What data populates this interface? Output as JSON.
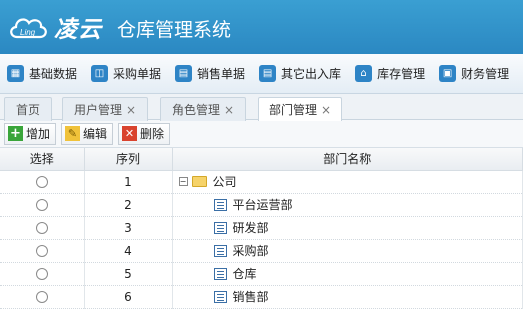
{
  "header": {
    "brand": "凌云",
    "logo_text": "Ling",
    "title": "仓库管理系统"
  },
  "nav": {
    "items": [
      {
        "label": "基础数据",
        "icon": "database-icon"
      },
      {
        "label": "采购单据",
        "icon": "basket-icon"
      },
      {
        "label": "销售单据",
        "icon": "calendar-icon"
      },
      {
        "label": "其它出入库",
        "icon": "calendar-icon"
      },
      {
        "label": "库存管理",
        "icon": "home-icon"
      },
      {
        "label": "财务管理",
        "icon": "finance-icon"
      }
    ]
  },
  "tabs": [
    {
      "label": "首页"
    },
    {
      "label": "用户管理",
      "close": "×"
    },
    {
      "label": "角色管理",
      "close": "×"
    },
    {
      "label": "部门管理",
      "close": "×"
    }
  ],
  "toolbar": {
    "add": "增加",
    "edit": "编辑",
    "delete": "删除"
  },
  "grid": {
    "headers": {
      "select": "选择",
      "index": "序列",
      "name": "部门名称"
    },
    "rows": [
      {
        "index": "1",
        "name": "公司"
      },
      {
        "index": "2",
        "name": "平台运营部"
      },
      {
        "index": "3",
        "name": "研发部"
      },
      {
        "index": "4",
        "name": "采购部"
      },
      {
        "index": "5",
        "name": "仓库"
      },
      {
        "index": "6",
        "name": "销售部"
      }
    ],
    "expander_symbol": "−"
  }
}
